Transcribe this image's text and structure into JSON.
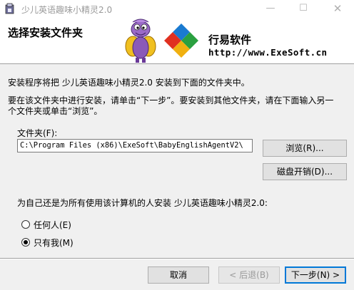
{
  "window": {
    "title": "少儿英语趣味小精灵2.0",
    "minimize_glyph": "—",
    "maximize_glyph": "☐",
    "close_glyph": "✕"
  },
  "banner": {
    "heading": "选择安装文件夹",
    "brand_name": "行易软件",
    "brand_url": "http://www.ExeSoft.cn"
  },
  "body": {
    "intro": "安装程序将把 少儿英语趣味小精灵2.0 安装到下面的文件夹中。",
    "instruction_line1": "要在该文件夹中进行安装，请单击“下一步”。要安装到其他文件夹，请在下面输入另一",
    "instruction_line2": "个文件夹或单击“浏览”。",
    "folder_label": "文件夹(F):",
    "folder_value": "C:\\Program Files (x86)\\ExeSoft\\BabyEnglishAgentV2\\",
    "browse_button": "浏览(R)...",
    "disk_cost_button": "磁盘开销(D)...",
    "install_for_question": "为自己还是为所有使用该计算机的人安装 少儿英语趣味小精灵2.0:",
    "options": [
      {
        "label": "任何人(E)",
        "checked": false
      },
      {
        "label": "只有我(M)",
        "checked": true
      }
    ]
  },
  "footer": {
    "cancel": "取消",
    "back": "< 后退(B)",
    "next": "下一步(N) >"
  },
  "colors": {
    "dialog_bg": "#f0f0f0",
    "default_button_border": "#0078d7"
  }
}
